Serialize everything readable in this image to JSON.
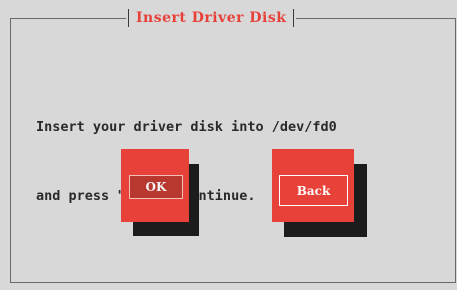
{
  "dialog": {
    "title": "Insert Driver Disk",
    "message_lines": [
      "Insert your driver disk into /dev/fd0",
      "and press \"OK\" to continue."
    ]
  },
  "buttons": {
    "ok_label": "OK",
    "back_label": "Back"
  },
  "colors": {
    "background": "#d8d8d8",
    "accent_red": "#e8413a",
    "text": "#2a2a2a",
    "shadow": "#1c1c1c"
  }
}
